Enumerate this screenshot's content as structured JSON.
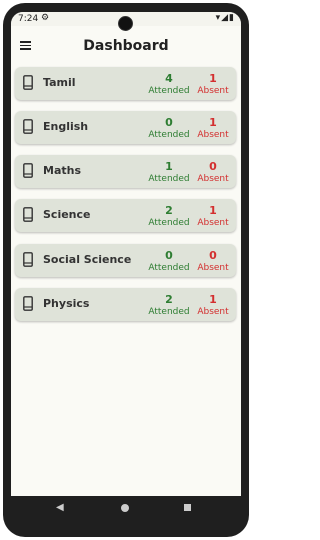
{
  "status_bar": {
    "time": "7:24",
    "settings_icon": "gear-icon",
    "right_icons": "wifi signal battery"
  },
  "app_bar": {
    "title": "Dashboard",
    "menu_icon": "hamburger-menu-icon"
  },
  "labels": {
    "attended": "Attended",
    "absent": "Absent"
  },
  "colors": {
    "attended": "#2e7d32",
    "absent": "#d32f2f",
    "card": "#dfe3d9",
    "background": "#fafaf5"
  },
  "subjects": [
    {
      "name": "Tamil",
      "attended": "4",
      "absent": "1"
    },
    {
      "name": "English",
      "attended": "0",
      "absent": "1"
    },
    {
      "name": "Maths",
      "attended": "1",
      "absent": "0"
    },
    {
      "name": "Science",
      "attended": "2",
      "absent": "1"
    },
    {
      "name": "Social Science",
      "attended": "0",
      "absent": "0"
    },
    {
      "name": "Physics",
      "attended": "2",
      "absent": "1"
    }
  ]
}
